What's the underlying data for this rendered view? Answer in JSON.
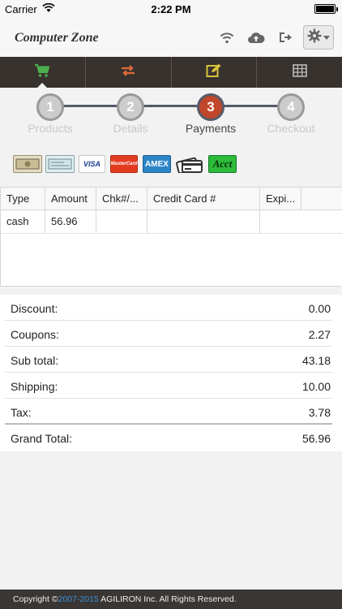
{
  "status_bar": {
    "carrier": "Carrier",
    "time": "2:22 PM"
  },
  "header": {
    "title": "Computer Zone",
    "icons": [
      "wifi-icon",
      "cloud-upload-icon",
      "logout-icon",
      "gear-icon"
    ]
  },
  "tabs": [
    {
      "icon": "cart-icon",
      "color": "#4caf50",
      "active": true
    },
    {
      "icon": "swap-arrows-icon",
      "color": "#e06a3a"
    },
    {
      "icon": "edit-icon",
      "color": "#d8c43a"
    },
    {
      "icon": "grid-icon",
      "color": "#bdbdbd"
    }
  ],
  "steps": [
    {
      "number": "1",
      "label": "Products"
    },
    {
      "number": "2",
      "label": "Details"
    },
    {
      "number": "3",
      "label": "Payments",
      "active": true
    },
    {
      "number": "4",
      "label": "Checkout"
    }
  ],
  "payment_methods": [
    {
      "name": "cash-icon",
      "label": ""
    },
    {
      "name": "check-icon",
      "label": ""
    },
    {
      "name": "visa-icon",
      "label": "VISA"
    },
    {
      "name": "mastercard-icon",
      "label": "MasterCard"
    },
    {
      "name": "amex-icon",
      "label": "AMEX"
    },
    {
      "name": "gift-card-icon",
      "label": ""
    },
    {
      "name": "account-icon",
      "label": "Acct"
    }
  ],
  "payment_grid": {
    "columns": [
      "Type",
      "Amount",
      "Chk#/...",
      "Credit Card #",
      "Expi..."
    ],
    "rows": [
      [
        "cash",
        "56.96",
        "",
        "",
        ""
      ]
    ]
  },
  "totals": {
    "discount": {
      "label": "Discount:",
      "value": "0.00"
    },
    "coupons": {
      "label": "Coupons:",
      "value": "2.27"
    },
    "subtotal": {
      "label": "Sub total:",
      "value": "43.18"
    },
    "shipping": {
      "label": "Shipping:",
      "value": "10.00"
    },
    "tax": {
      "label": "Tax:",
      "value": "3.78"
    },
    "grand_total": {
      "label": "Grand Total:",
      "value": "56.96"
    }
  },
  "footer": {
    "prefix": "Copyright ©",
    "years": "2007-2015",
    "suffix": " AGILIRON Inc. All Rights Reserved."
  }
}
